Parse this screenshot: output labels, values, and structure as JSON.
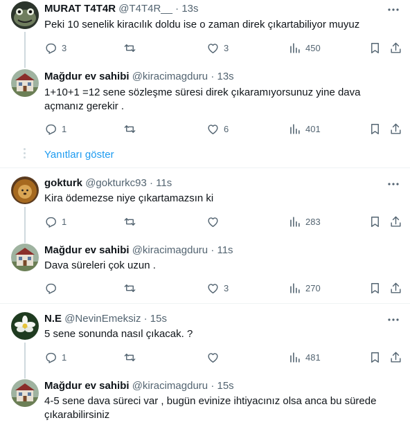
{
  "thread": [
    {
      "name": "MURAT T4T4R",
      "handle": "@T4T4R__",
      "dot": "·",
      "time": "13s",
      "text": "Peki 10 senelik kiracılık doldu ise o zaman direk çıkartabiliyor muyuz",
      "replies": "3",
      "retweets": "",
      "likes": "3",
      "views": "450",
      "avatar": "frog-avatar"
    },
    {
      "name": "Mağdur ev sahibi",
      "handle": "@kiracimagduru",
      "dot": "·",
      "time": "13s",
      "text": "1+10+1 =12 sene sözleşme süresi direk çıkaramıyorsunuz yine dava açmanız gerekir .",
      "replies": "1",
      "retweets": "",
      "likes": "6",
      "views": "401",
      "avatar": "house-avatar"
    },
    {
      "name": "gokturk",
      "handle": "@gokturkc93",
      "dot": "·",
      "time": "11s",
      "text": "Kira ödemezse niye çıkartamazsın ki",
      "replies": "1",
      "retweets": "",
      "likes": "",
      "views": "283",
      "avatar": "lion-avatar"
    },
    {
      "name": "Mağdur ev sahibi",
      "handle": "@kiracimagduru",
      "dot": "·",
      "time": "11s",
      "text": "Dava süreleri çok uzun .",
      "replies": "",
      "retweets": "",
      "likes": "3",
      "views": "270",
      "avatar": "house-avatar"
    },
    {
      "name": "N.E",
      "handle": "@NevinEmeksiz",
      "dot": "·",
      "time": "15s",
      "text": "5 sene sonunda nasıl çıkacak. ?",
      "replies": "1",
      "retweets": "",
      "likes": "",
      "views": "481",
      "avatar": "flower-avatar"
    },
    {
      "name": "Mağdur ev sahibi",
      "handle": "@kiracimagduru",
      "dot": "·",
      "time": "15s",
      "text": "4-5 sene dava süreci var , bugün evinize ihtiyacınız olsa anca bu sürede çıkarabilirsiniz",
      "replies": "",
      "retweets": "",
      "likes": "",
      "views": "",
      "avatar": "house-avatar"
    }
  ],
  "show_replies_label": "Yanıtları göster",
  "colors": {
    "link": "#1d9bf0",
    "muted": "#536471",
    "text": "#0f1419",
    "thread_line": "#cfd9de",
    "divider": "#eff3f4"
  }
}
